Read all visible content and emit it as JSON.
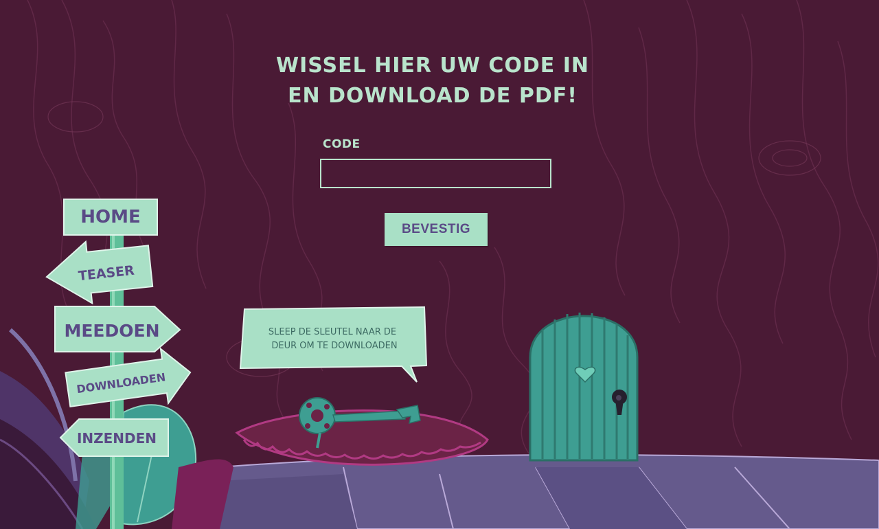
{
  "page": {
    "heading_line1": "WISSEL HIER UW CODE IN",
    "heading_line2": "EN DOWNLOAD DE PDF!"
  },
  "form": {
    "code_label": "CODE",
    "code_value": "",
    "confirm_label": "BEVESTIG"
  },
  "nav": {
    "items": [
      {
        "label": "HOME"
      },
      {
        "label": "TEASER"
      },
      {
        "label": "MEEDOEN"
      },
      {
        "label": "DOWNLOADEN"
      },
      {
        "label": "INZENDEN"
      }
    ]
  },
  "hint": {
    "line1": "SLEEP DE SLEUTEL NAAR DE",
    "line2": "DEUR OM TE DOWNLOADEN"
  },
  "icons": {
    "key": "key-icon",
    "door": "door-icon",
    "heart": "heart-icon",
    "keyhole": "keyhole-icon"
  },
  "colors": {
    "background": "#4a1a35",
    "mint": "#b9e4cc",
    "sign_text": "#5a4a86",
    "teal": "#3e9e92",
    "cushion": "#6b2346",
    "cushion_trim": "#b13a83",
    "floor": "#655a8c"
  }
}
